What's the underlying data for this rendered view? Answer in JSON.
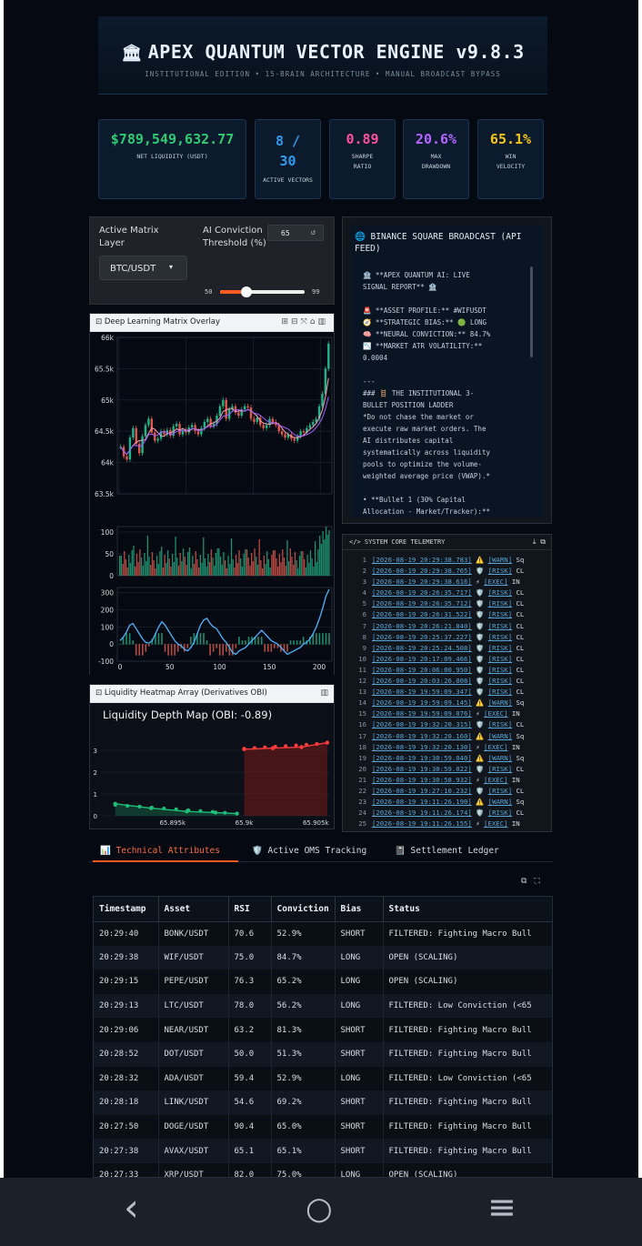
{
  "header": {
    "icon": "bank-icon",
    "title": "APEX QUANTUM VECTOR ENGINE v9.8.3",
    "subtitle": "INSTITUTIONAL EDITION • 15-BRAIN ARCHITECTURE • MANUAL BROADCAST BYPASS"
  },
  "metrics": [
    {
      "value": "$789,549,632.77",
      "label": "NET LIQUIDITY (USDT)",
      "color": "#2ecc71"
    },
    {
      "value": "8 / 30",
      "label": "ACTIVE VECTORS",
      "color": "#2e9bf0"
    },
    {
      "value": "0.89",
      "label": "SHARPE RATIO",
      "color": "#ff4fa3"
    },
    {
      "value": "20.6%",
      "label": "MAX DRAWDOWN",
      "color": "#b266ff"
    },
    {
      "value": "65.1%",
      "label": "WIN VELOCITY",
      "color": "#f5c518"
    }
  ],
  "controls": {
    "layer_label": "Active Matrix Layer",
    "layer_value": "BTC/USDT",
    "threshold_label": "AI Conviction Threshold (%)",
    "threshold_value": "65",
    "slider_min": "50",
    "slider_max": "99",
    "slider_fraction": 0.31
  },
  "broadcast": {
    "title": "🌐 BINANCE SQUARE BROADCAST (API FEED)",
    "body": "🏦 **APEX QUANTUM AI: LIVE\nSIGNAL REPORT** 🏦\n\n🚨 **ASSET PROFILE:** #WIFUSDT\n🧭 **STRATEGIC BIAS:** 🟢 LONG\n🧠 **NEURAL CONVICTION:** 84.7%\n📉 **MARKET ATR VOLATILITY:**\n0.0004\n\n---\n### 🪜 THE INSTITUTIONAL 3-\nBULLET POSITION LADDER\n*Do not chase the market or\nexecute raw market orders. The\nAI distributes capital\nsystematically across liquidity\npools to optimize the volume-\nweighted average price (VWAP).*\n\n• **Bullet 1 (30% Capital\nAllocation - Market/Tracker):**"
  },
  "chart_panel": {
    "title": "Deep Learning Matrix Overlay",
    "tool_icons": [
      "plus-square-icon",
      "minus-square-icon",
      "autoscale-icon",
      "home-icon",
      "plotly-icon"
    ]
  },
  "heatmap_panel": {
    "title": "Liquidity Heatmap Array (Derivatives OBI)",
    "chart_title": "Liquidity Depth Map (OBI: -0.89)"
  },
  "telemetry": {
    "title": "SYSTEM CORE TELEMETRY",
    "rows": [
      {
        "n": "1",
        "ts": "[2026-08-19 20:29:38.783]",
        "icon": "⚠️",
        "lv": "[WARN]",
        "tx": "Sq"
      },
      {
        "n": "2",
        "ts": "[2026-08-19 20:29:38.765]",
        "icon": "🛡️",
        "lv": "[RISK]",
        "tx": "CL"
      },
      {
        "n": "3",
        "ts": "[2026-08-19 20:29:38.616]",
        "icon": "⚡",
        "lv": "[EXEC]",
        "tx": "IN"
      },
      {
        "n": "4",
        "ts": "[2026-08-19 20:26:35.717]",
        "icon": "🛡️",
        "lv": "[RISK]",
        "tx": "CL"
      },
      {
        "n": "5",
        "ts": "[2026-08-19 20:26:35.712]",
        "icon": "🛡️",
        "lv": "[RISK]",
        "tx": "CL"
      },
      {
        "n": "6",
        "ts": "[2026-08-19 20:26:31.522]",
        "icon": "🛡️",
        "lv": "[RISK]",
        "tx": "CL"
      },
      {
        "n": "7",
        "ts": "[2026-08-19 20:26:21.840]",
        "icon": "🛡️",
        "lv": "[RISK]",
        "tx": "CL"
      },
      {
        "n": "8",
        "ts": "[2026-08-19 20:25:37.227]",
        "icon": "🛡️",
        "lv": "[RISK]",
        "tx": "CL"
      },
      {
        "n": "9",
        "ts": "[2026-08-19 20:25:24.508]",
        "icon": "🛡️",
        "lv": "[RISK]",
        "tx": "CL"
      },
      {
        "n": "10",
        "ts": "[2026-08-19 20:17:09.466]",
        "icon": "🛡️",
        "lv": "[RISK]",
        "tx": "CL"
      },
      {
        "n": "11",
        "ts": "[2026-08-19 20:06:00.950]",
        "icon": "🛡️",
        "lv": "[RISK]",
        "tx": "CL"
      },
      {
        "n": "12",
        "ts": "[2026-08-19 20:03:26.008]",
        "icon": "🛡️",
        "lv": "[RISK]",
        "tx": "CL"
      },
      {
        "n": "13",
        "ts": "[2026-08-19 19:59:09.347]",
        "icon": "🛡️",
        "lv": "[RISK]",
        "tx": "CL"
      },
      {
        "n": "14",
        "ts": "[2026-08-19 19:59:09.145]",
        "icon": "⚠️",
        "lv": "[WARN]",
        "tx": "Sq"
      },
      {
        "n": "15",
        "ts": "[2026-08-19 19:59:09.076]",
        "icon": "⚡",
        "lv": "[EXEC]",
        "tx": "IN"
      },
      {
        "n": "16",
        "ts": "[2026-08-19 19:32:20.315]",
        "icon": "🛡️",
        "lv": "[RISK]",
        "tx": "CL"
      },
      {
        "n": "17",
        "ts": "[2026-08-19 19:32:20.160]",
        "icon": "⚠️",
        "lv": "[WARN]",
        "tx": "Sq"
      },
      {
        "n": "18",
        "ts": "[2026-08-19 19:32:20.130]",
        "icon": "⚡",
        "lv": "[EXEC]",
        "tx": "IN"
      },
      {
        "n": "19",
        "ts": "[2026-08-19 19:30:59.040]",
        "icon": "⚠️",
        "lv": "[WARN]",
        "tx": "Sq"
      },
      {
        "n": "20",
        "ts": "[2026-08-19 19:30:59.022]",
        "icon": "🛡️",
        "lv": "[RISK]",
        "tx": "CL"
      },
      {
        "n": "21",
        "ts": "[2026-08-19 19:30:58.932]",
        "icon": "⚡",
        "lv": "[EXEC]",
        "tx": "IN"
      },
      {
        "n": "22",
        "ts": "[2026-08-19 19:27:10.232]",
        "icon": "🛡️",
        "lv": "[RISK]",
        "tx": "CL"
      },
      {
        "n": "23",
        "ts": "[2026-08-19 19:11:26.190]",
        "icon": "⚠️",
        "lv": "[WARN]",
        "tx": "Sq"
      },
      {
        "n": "24",
        "ts": "[2026-08-19 19:11:26.174]",
        "icon": "🛡️",
        "lv": "[RISK]",
        "tx": "CL"
      },
      {
        "n": "25",
        "ts": "[2026-08-19 19:11:26.155]",
        "icon": "⚡",
        "lv": "[EXEC]",
        "tx": "IN"
      }
    ]
  },
  "tabs": [
    {
      "label": "📊 Technical Attributes",
      "active": true
    },
    {
      "label": "🛡️ Active OMS Tracking",
      "active": false
    },
    {
      "label": "📓 Settlement Ledger",
      "active": false
    }
  ],
  "table": {
    "columns": [
      "Timestamp",
      "Asset",
      "RSI",
      "Conviction",
      "Bias",
      "Status"
    ],
    "rows": [
      [
        "20:29:40",
        "BONK/USDT",
        "70.6",
        "52.9%",
        "SHORT",
        "FILTERED: Fighting Macro Bull"
      ],
      [
        "20:29:38",
        "WIF/USDT",
        "75.0",
        "84.7%",
        "LONG",
        "OPEN (SCALING)"
      ],
      [
        "20:29:15",
        "PEPE/USDT",
        "76.3",
        "65.2%",
        "LONG",
        "OPEN (SCALING)"
      ],
      [
        "20:29:13",
        "LTC/USDT",
        "78.0",
        "56.2%",
        "LONG",
        "FILTERED: Low Conviction (<65"
      ],
      [
        "20:29:06",
        "NEAR/USDT",
        "63.2",
        "81.3%",
        "SHORT",
        "FILTERED: Fighting Macro Bull"
      ],
      [
        "20:28:52",
        "DOT/USDT",
        "50.0",
        "51.3%",
        "SHORT",
        "FILTERED: Fighting Macro Bull"
      ],
      [
        "20:28:32",
        "ADA/USDT",
        "59.4",
        "52.9%",
        "LONG",
        "FILTERED: Low Conviction (<65"
      ],
      [
        "20:28:18",
        "LINK/USDT",
        "54.6",
        "69.2%",
        "SHORT",
        "FILTERED: Fighting Macro Bull"
      ],
      [
        "20:27:50",
        "DOGE/USDT",
        "90.4",
        "65.0%",
        "SHORT",
        "FILTERED: Fighting Macro Bull"
      ],
      [
        "20:27:38",
        "AVAX/USDT",
        "65.1",
        "65.1%",
        "SHORT",
        "FILTERED: Fighting Macro Bull"
      ],
      [
        "20:27:33",
        "XRP/USDT",
        "82.0",
        "75.0%",
        "LONG",
        "OPEN (SCALING)"
      ]
    ]
  },
  "chart_data": [
    {
      "type": "line",
      "name": "price",
      "yticks": [
        "66k",
        "65.5k",
        "65k",
        "64.5k",
        "64k",
        "63.5k"
      ],
      "ylim": [
        63500,
        66000
      ],
      "xlim": [
        0,
        210
      ],
      "close": [
        64250,
        64100,
        64050,
        64400,
        64550,
        64300,
        64150,
        64420,
        64600,
        64700,
        64480,
        64350,
        64380,
        64500,
        64450,
        64520,
        64430,
        64580,
        64620,
        64450,
        64520,
        64480,
        64560,
        64600,
        64500,
        64450,
        64550,
        64650,
        64700,
        64580,
        64620,
        64750,
        64900,
        65000,
        64700,
        64850,
        64900,
        64800,
        64750,
        64850,
        64900,
        64880,
        64700,
        64650,
        64720,
        64600,
        64550,
        64600,
        64700,
        64650,
        64600,
        64500,
        64450,
        64400,
        64450,
        64380,
        64350,
        64420,
        64500,
        64480,
        64550,
        64600,
        64650,
        64700,
        64900,
        65100,
        65500,
        65900
      ]
    },
    {
      "type": "bar",
      "name": "volume",
      "yticks": [
        "100",
        "50",
        "0"
      ],
      "ylim": [
        0,
        100
      ]
    },
    {
      "type": "line",
      "name": "macd",
      "yticks": [
        "300",
        "200",
        "100",
        "0",
        "-100"
      ],
      "xticks": [
        "0",
        "50",
        "100",
        "150",
        "200"
      ],
      "ylim": [
        -100,
        330
      ],
      "values": [
        20,
        40,
        70,
        110,
        120,
        90,
        60,
        30,
        10,
        5,
        20,
        60,
        100,
        130,
        110,
        80,
        50,
        20,
        0,
        -10,
        -30,
        -40,
        -20,
        10,
        60,
        110,
        140,
        150,
        120,
        100,
        90,
        60,
        30,
        10,
        -20,
        -50,
        -60,
        -40,
        -30,
        -20,
        0,
        20,
        40,
        60,
        80,
        60,
        40,
        20,
        10,
        0,
        -20,
        -40,
        -60,
        -50,
        -40,
        -30,
        -20,
        0,
        10,
        30,
        60,
        100,
        150,
        210,
        280,
        320
      ]
    },
    {
      "type": "area",
      "name": "liquidity depth",
      "title": "Liquidity Depth Map (OBI: -0.89)",
      "yticks": [
        "3",
        "2",
        "1",
        "0"
      ],
      "xticks": [
        "65.895k",
        "65.9k",
        "65.905k"
      ],
      "ylim": [
        0,
        3.5
      ],
      "bids": [
        [
          65891,
          0.55
        ],
        [
          65893.5,
          0.35
        ],
        [
          65896,
          0.2
        ],
        [
          65898,
          0.15
        ],
        [
          65899.5,
          0.1
        ]
      ],
      "asks": [
        [
          65900,
          3.05
        ],
        [
          65902,
          3.1
        ],
        [
          65904,
          3.15
        ],
        [
          65905.8,
          3.35
        ]
      ]
    }
  ],
  "nav": {
    "back": "‹",
    "home": "○",
    "recents": "≡"
  }
}
